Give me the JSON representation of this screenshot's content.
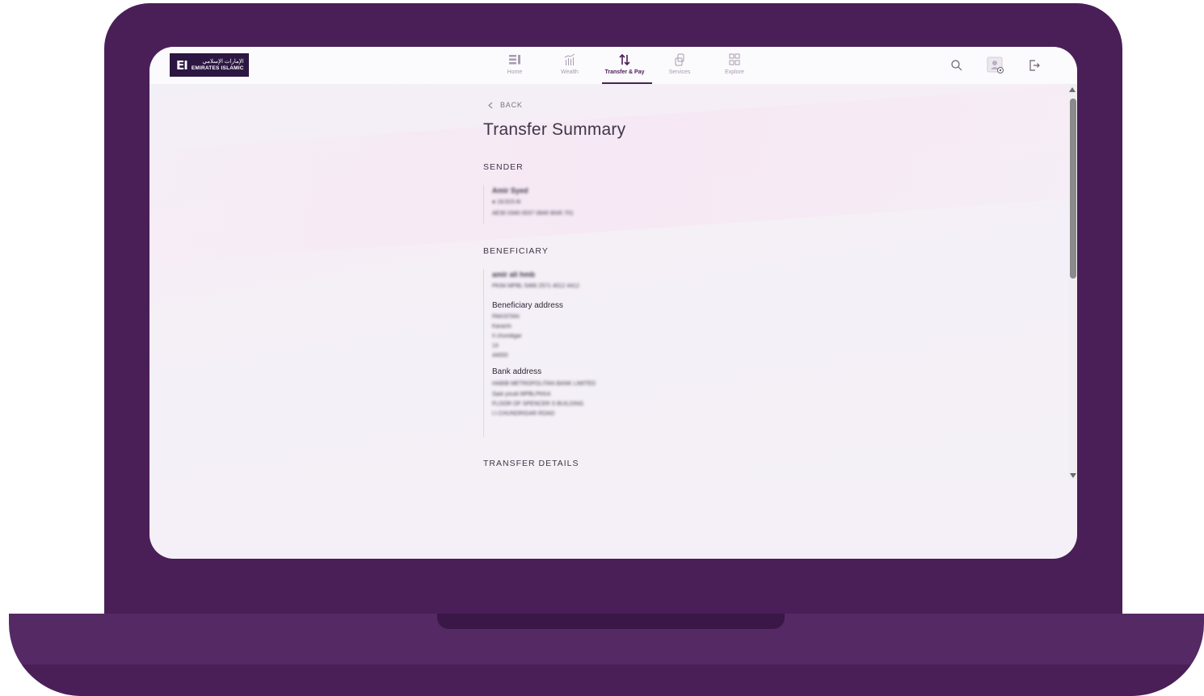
{
  "logo": {
    "arabic": "الإمارات الإسلامي",
    "english": "EMIRATES ISLAMIC",
    "mark": "EI"
  },
  "nav": {
    "items": [
      {
        "label": "Home",
        "icon": "home-icon"
      },
      {
        "label": "Wealth",
        "icon": "wealth-icon"
      },
      {
        "label": "Transfer & Pay",
        "icon": "transfer-icon",
        "active": true
      },
      {
        "label": "Services",
        "icon": "services-icon"
      },
      {
        "label": "Explore",
        "icon": "explore-icon"
      }
    ]
  },
  "back_label": "BACK",
  "page_title": "Transfer Summary",
  "sender": {
    "heading": "SENDER",
    "name": "Amir Syed",
    "account": "● 18,915 Al",
    "iban": "AE30 0340 0037 0849 9045 701"
  },
  "beneficiary": {
    "heading": "BENEFICIARY",
    "name": "amir ali hmb",
    "iban": "PK94 MPBL 5466 2571 4012 4412",
    "address_heading": "Beneficiary address",
    "address_lines": [
      "PAKISTAN",
      "Karachi",
      "II chundigar",
      "14",
      "44000"
    ],
    "bank_heading": "Bank address",
    "bank_lines": [
      "HABIB METROPOLITAN BANK LIMITED",
      "Sadi youdi MPBLPKKA",
      "FLOOR OF SPENCER S BUILDING",
      "I.I CHUNDRIGAR ROAD"
    ]
  },
  "transfer_details": {
    "heading": "TRANSFER DETAILS"
  },
  "colors": {
    "brand": "#4a1f58",
    "logo_bg": "#2c1642",
    "nav_inactive": "#a79cb0"
  }
}
